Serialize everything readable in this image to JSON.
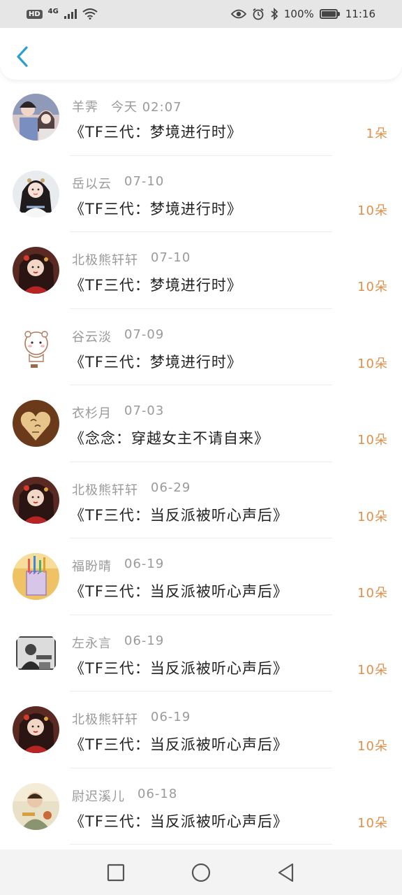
{
  "status_bar": {
    "hd": "HD",
    "network": "4G",
    "battery_text": "100%",
    "time": "11:16"
  },
  "colors": {
    "count": "#e0904a",
    "meta": "#9a9a9a",
    "accent_back": "#2a9fd6"
  },
  "records": [
    {
      "user": "羊霁",
      "date": "今天 02:07",
      "title": "《TF三代：梦境进行时》",
      "count": "1朵",
      "avatar": "avatar-couple"
    },
    {
      "user": "岳以云",
      "date": "07-10",
      "title": "《TF三代：梦境进行时》",
      "count": "10朵",
      "avatar": "avatar-girl-white"
    },
    {
      "user": "北极熊轩轩",
      "date": "07-10",
      "title": "《TF三代：梦境进行时》",
      "count": "10朵",
      "avatar": "avatar-girl-red"
    },
    {
      "user": "谷云淡",
      "date": "07-09",
      "title": "《TF三代：梦境进行时》",
      "count": "10朵",
      "avatar": "avatar-cartoon"
    },
    {
      "user": "衣杉月",
      "date": "07-03",
      "title": "《念念：穿越女主不请自来》",
      "count": "10朵",
      "avatar": "avatar-heart"
    },
    {
      "user": "北极熊轩轩",
      "date": "06-29",
      "title": "《TF三代：当反派被听心声后》",
      "count": "10朵",
      "avatar": "avatar-girl-red"
    },
    {
      "user": "福盼晴",
      "date": "06-19",
      "title": "《TF三代：当反派被听心声后》",
      "count": "10朵",
      "avatar": "avatar-pencils"
    },
    {
      "user": "左永言",
      "date": "06-19",
      "title": "《TF三代：当反派被听心声后》",
      "count": "10朵",
      "avatar": "avatar-photo-bw"
    },
    {
      "user": "北极熊轩轩",
      "date": "06-19",
      "title": "《TF三代：当反派被听心声后》",
      "count": "10朵",
      "avatar": "avatar-girl-red"
    },
    {
      "user": "尉迟溪儿",
      "date": "06-18",
      "title": "《TF三代：当反派被听心声后》",
      "count": "10朵",
      "avatar": "avatar-boy-eating"
    }
  ]
}
